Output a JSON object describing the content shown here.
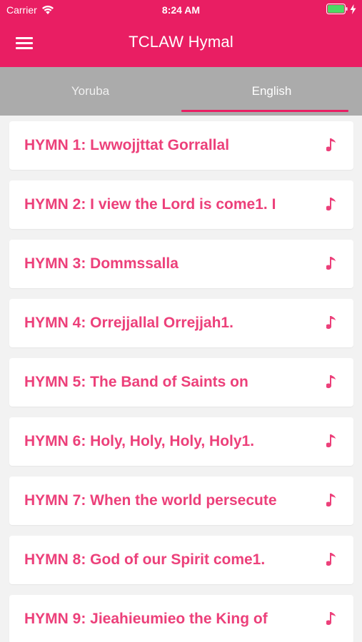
{
  "status_bar": {
    "carrier": "Carrier",
    "time": "8:24 AM"
  },
  "app_bar": {
    "title": "TCLAW Hymal",
    "menu_icon": "hamburger-menu-icon"
  },
  "tabs": [
    {
      "label": "Yoruba",
      "selected": false
    },
    {
      "label": "English",
      "selected": true
    }
  ],
  "hymns": [
    {
      "title": "HYMN 1: Lwwojjttat Gorrallal"
    },
    {
      "title": "HYMN 2: I view the Lord is come1. I"
    },
    {
      "title": "HYMN 3: Dommssalla"
    },
    {
      "title": "HYMN 4: Orrejjallal Orrejjah1."
    },
    {
      "title": "HYMN 5: The Band of Saints on"
    },
    {
      "title": "HYMN 6: Holy, Holy, Holy, Holy1."
    },
    {
      "title": "HYMN 7: When the world persecute"
    },
    {
      "title": "HYMN 8: God of our Spirit come1."
    },
    {
      "title": "HYMN 9: Jieahieumieo the King of"
    }
  ],
  "colors": {
    "accent": "#e91e63",
    "hymn_text": "#ec407a",
    "tab_bar": "#ababab",
    "background": "#f2f2f2"
  }
}
